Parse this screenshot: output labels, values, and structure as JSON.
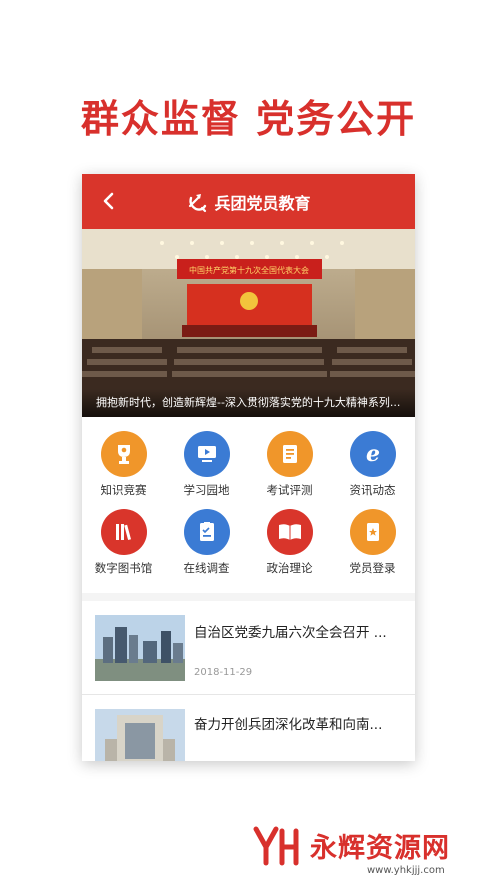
{
  "headline": "群众监督 党务公开",
  "colors": {
    "brand_red": "#d9352b",
    "accent_orange": "#f0962a",
    "accent_blue": "#3b7bd4"
  },
  "navbar": {
    "back_icon": "chevron-left-icon",
    "emblem_icon": "party-emblem-icon",
    "title": "兵团党员教育"
  },
  "banner": {
    "caption": "拥抱新时代，创造新辉煌--深入贯彻落实党的十九大精神系列...",
    "screen_text": "中国共产党第十九次全国代表大会"
  },
  "grid": [
    {
      "label": "知识竞赛",
      "icon": "trophy-icon"
    },
    {
      "label": "学习园地",
      "icon": "monitor-icon"
    },
    {
      "label": "考试评测",
      "icon": "document-icon"
    },
    {
      "label": "资讯动态",
      "icon": "browser-e-icon"
    },
    {
      "label": "数字图书馆",
      "icon": "bookshelf-icon"
    },
    {
      "label": "在线调查",
      "icon": "clipboard-icon"
    },
    {
      "label": "政治理论",
      "icon": "open-book-icon"
    },
    {
      "label": "党员登录",
      "icon": "member-badge-icon"
    }
  ],
  "news": [
    {
      "title": "自治区党委九届六次全会召开 ...",
      "date": "2018-11-29"
    },
    {
      "title": "奋力开创兵团深化改革和向南..."
    }
  ],
  "watermark": {
    "logo_text": "永辉资源网",
    "url": "www.yhkjjj.com"
  }
}
